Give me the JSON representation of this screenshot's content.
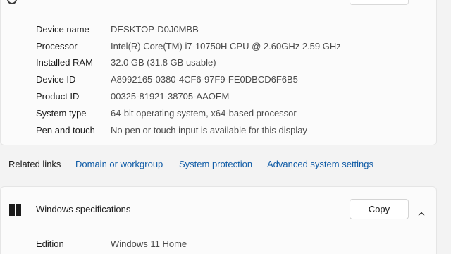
{
  "device_specs": {
    "rows": [
      {
        "label": "Device name",
        "value": "DESKTOP-D0J0MBB"
      },
      {
        "label": "Processor",
        "value": "Intel(R) Core(TM) i7-10750H CPU @ 2.60GHz   2.59 GHz"
      },
      {
        "label": "Installed RAM",
        "value": "32.0 GB (31.8 GB usable)"
      },
      {
        "label": "Device ID",
        "value": "A8992165-0380-4CF6-97F9-FE0DBCD6F6B5"
      },
      {
        "label": "Product ID",
        "value": "00325-81921-38705-AAOEM"
      },
      {
        "label": "System type",
        "value": "64-bit operating system, x64-based processor"
      },
      {
        "label": "Pen and touch",
        "value": "No pen or touch input is available for this display"
      }
    ]
  },
  "related_links": {
    "title": "Related links",
    "links": [
      "Domain or workgroup",
      "System protection",
      "Advanced system settings"
    ]
  },
  "windows_specs": {
    "title": "Windows specifications",
    "copy_label": "Copy",
    "logo_icon": "windows-logo-icon",
    "chevron_icon": "chevron-up-icon",
    "rows": [
      {
        "label": "Edition",
        "value": "Windows 11 Home"
      }
    ]
  },
  "colors": {
    "link": "#0f5ba6",
    "card": "#fbfbfb",
    "background": "#f3f3f3"
  }
}
